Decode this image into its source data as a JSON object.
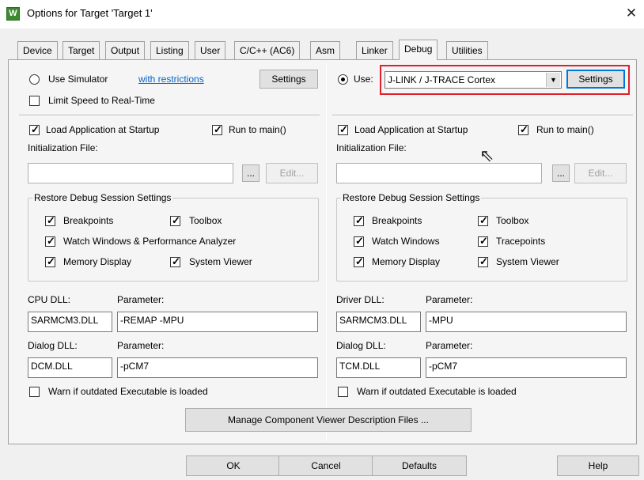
{
  "window": {
    "title": "Options for Target 'Target 1'",
    "icon_letter": "W",
    "close_glyph": "✕"
  },
  "tabs": [
    {
      "label": "Device"
    },
    {
      "label": "Target"
    },
    {
      "label": "Output"
    },
    {
      "label": "Listing"
    },
    {
      "label": "User"
    },
    {
      "label": "C/C++ (AC6)"
    },
    {
      "label": "Asm"
    },
    {
      "label": "Linker"
    },
    {
      "label": "Debug",
      "active": true
    },
    {
      "label": "Utilities"
    }
  ],
  "left": {
    "use_simulator": "Use Simulator",
    "with_restrictions": "with restrictions",
    "settings": "Settings",
    "limit_speed": "Limit Speed to Real-Time",
    "load_app": "Load Application at Startup",
    "run_to_main": "Run to main()",
    "init_file_label": "Initialization File:",
    "browse": "...",
    "edit": "Edit...",
    "restore_title": "Restore Debug Session Settings",
    "breakpoints": "Breakpoints",
    "toolbox": "Toolbox",
    "watch_windows": "Watch Windows & Performance Analyzer",
    "memory_display": "Memory Display",
    "system_viewer": "System Viewer",
    "cpu_dll_label": "CPU DLL:",
    "cpu_param_label": "Parameter:",
    "cpu_dll_value": "SARMCM3.DLL",
    "cpu_param_value": "-REMAP -MPU",
    "dialog_dll_label": "Dialog DLL:",
    "dialog_param_label": "Parameter:",
    "dialog_dll_value": "DCM.DLL",
    "dialog_param_value": "-pCM7",
    "warn": "Warn if outdated Executable is loaded"
  },
  "right": {
    "use_label": "Use:",
    "driver_selected": "J-LINK / J-TRACE Cortex",
    "settings": "Settings",
    "load_app": "Load Application at Startup",
    "run_to_main": "Run to main()",
    "init_file_label": "Initialization File:",
    "browse": "...",
    "edit": "Edit...",
    "restore_title": "Restore Debug Session Settings",
    "breakpoints": "Breakpoints",
    "toolbox": "Toolbox",
    "watch_windows": "Watch Windows",
    "tracepoints": "Tracepoints",
    "memory_display": "Memory Display",
    "system_viewer": "System Viewer",
    "driver_dll_label": "Driver DLL:",
    "driver_param_label": "Parameter:",
    "driver_dll_value": "SARMCM3.DLL",
    "driver_param_value": "-MPU",
    "dialog_dll_label": "Dialog DLL:",
    "dialog_param_label": "Parameter:",
    "dialog_dll_value": "TCM.DLL",
    "dialog_param_value": "-pCM7",
    "warn": "Warn if outdated Executable is loaded"
  },
  "manage_button": "Manage Component Viewer Description Files ...",
  "footer": {
    "ok": "OK",
    "cancel": "Cancel",
    "defaults": "Defaults",
    "help": "Help"
  },
  "colors": {
    "highlight_box": "#e0202a",
    "link": "#0066cc",
    "focus": "#0078d7"
  }
}
